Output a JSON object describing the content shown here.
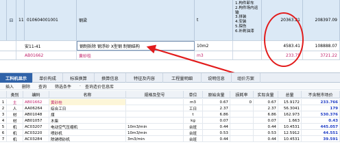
{
  "top": {
    "big_row": {
      "expand_icon": "⊟",
      "index": "11",
      "code": "010604001001",
      "name": "钢梁",
      "unit": "t",
      "features": [
        "1.构件卸车",
        "2.构件场内运",
        "输",
        "3.拼装",
        "4.安装",
        "5.探伤",
        "6.补刷油漆"
      ],
      "price": "20363.21",
      "total": "208397.09"
    },
    "row_b": {
      "code": "安11-41",
      "name": "钢制拆除 钢浮砂 X型钢 制钢结构",
      "unit": "10m2",
      "price": "4583.41",
      "total": "108888.07"
    },
    "row_c": {
      "code": "AB01662",
      "name": "黄砂桂",
      "unit": "m3",
      "price": "233.75",
      "total": "3721.22"
    }
  },
  "tabs": [
    "工料机显示",
    "单价构成",
    "标准换算",
    "换算信息",
    "特征及内容",
    "工程量明细",
    "说明信息",
    "组价方案"
  ],
  "toolbar": [
    "插入",
    "删除",
    "查询",
    "筛选条件",
    "查询造价信息库"
  ],
  "columns": [
    "类别",
    "编码",
    "名称",
    "规格及型号",
    "单位",
    "原始含量",
    "损耗率",
    "实际含量",
    "总量",
    "不含税市场价"
  ],
  "rows": [
    {
      "idx": "1",
      "cat": "主",
      "code": "AB01662",
      "name": "黄砂桂",
      "spec": "",
      "unit": "m3",
      "orig": "0.67",
      "loss": "0",
      "actual": "0.67",
      "total": "15.9172",
      "price": "233.766"
    },
    {
      "idx": "2",
      "cat": "人",
      "code": "AA06264",
      "name": "综合工日",
      "spec": "",
      "unit": "工日",
      "orig": "2.37",
      "loss": "",
      "actual": "2.37",
      "total": "56.3041",
      "price": "179"
    },
    {
      "idx": "3",
      "cat": "材",
      "code": "AB01048",
      "name": "煤",
      "spec": "",
      "unit": "t",
      "orig": "6.86",
      "loss": "",
      "actual": "6.86",
      "total": "162.973",
      "price": "530.376"
    },
    {
      "idx": "4",
      "cat": "材",
      "code": "AB01057",
      "name": "木柴",
      "spec": "",
      "unit": "kg",
      "orig": "0.07",
      "loss": "",
      "actual": "0.07",
      "total": "1.663",
      "price": "0.43"
    },
    {
      "idx": "5",
      "cat": "机",
      "code": "AC03207",
      "name": "电动空气压缩机",
      "spec": "10m3/min",
      "unit": "台班",
      "orig": "0.44",
      "loss": "",
      "actual": "0.44",
      "total": "10.4531",
      "price": "445.057"
    },
    {
      "idx": "6",
      "cat": "机",
      "code": "AC03220",
      "name": "喷砂机",
      "spec": "10m3/min",
      "unit": "台班",
      "orig": "0.53",
      "loss": "",
      "actual": "0.53",
      "total": "12.5912",
      "price": "44.551"
    },
    {
      "idx": "7",
      "cat": "机",
      "code": "AC03284",
      "name": "除锈喷砂机",
      "spec": "3m3/min",
      "unit": "台班",
      "orig": "0.44",
      "loss": "",
      "actual": "0.44",
      "total": "10.4531",
      "price": "39.591"
    }
  ]
}
